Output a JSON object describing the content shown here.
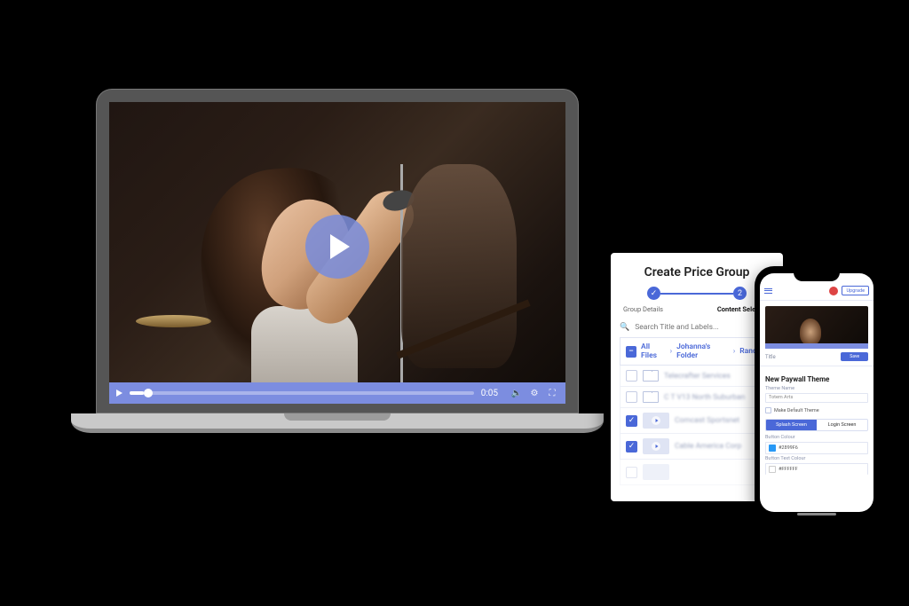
{
  "laptop": {
    "player": {
      "time": "0:05",
      "volume_icon": "🔈",
      "settings_icon": "⚙",
      "fullscreen_icon": "⛶"
    }
  },
  "tablet": {
    "title": "Create Price Group",
    "steps": {
      "done_icon": "✓",
      "current_num": "2",
      "label_1": "Group Details",
      "label_2": "Content Selection"
    },
    "search": {
      "icon": "🔍",
      "placeholder": "Search Title and Labels..."
    },
    "breadcrumb": {
      "minus": "–",
      "part1": "All Files",
      "sep": "›",
      "part2": "Johanna's Folder",
      "part3": "Random"
    },
    "rows": [
      {
        "checked": false,
        "type": "folder",
        "label": "Telecrafter Services"
      },
      {
        "checked": false,
        "type": "folder",
        "label": "C T V13 North Suburban"
      },
      {
        "checked": true,
        "type": "video",
        "label": "Comcast Sportsnet"
      },
      {
        "checked": true,
        "type": "video",
        "label": "Cable America Corp"
      }
    ]
  },
  "phone": {
    "header": {
      "upgrade": "Upgrade"
    },
    "video": {
      "title_label": "Title",
      "action": "Save"
    },
    "paywall": {
      "heading": "New Paywall Theme",
      "theme_name_lbl": "Theme Name",
      "theme_name_val": "Totem Arts",
      "make_default": "Make Default Theme",
      "seg_splash": "Splash Screen",
      "seg_login": "Login Screen",
      "button_colour_lbl": "Button Colour",
      "button_colour_val": "#2899F6",
      "button_colour_hex": "#2899F6",
      "button_text_colour_lbl": "Button Text Colour",
      "button_text_colour_val": "#FFFFFF",
      "button_text_colour_hex": "#ffffff"
    }
  }
}
